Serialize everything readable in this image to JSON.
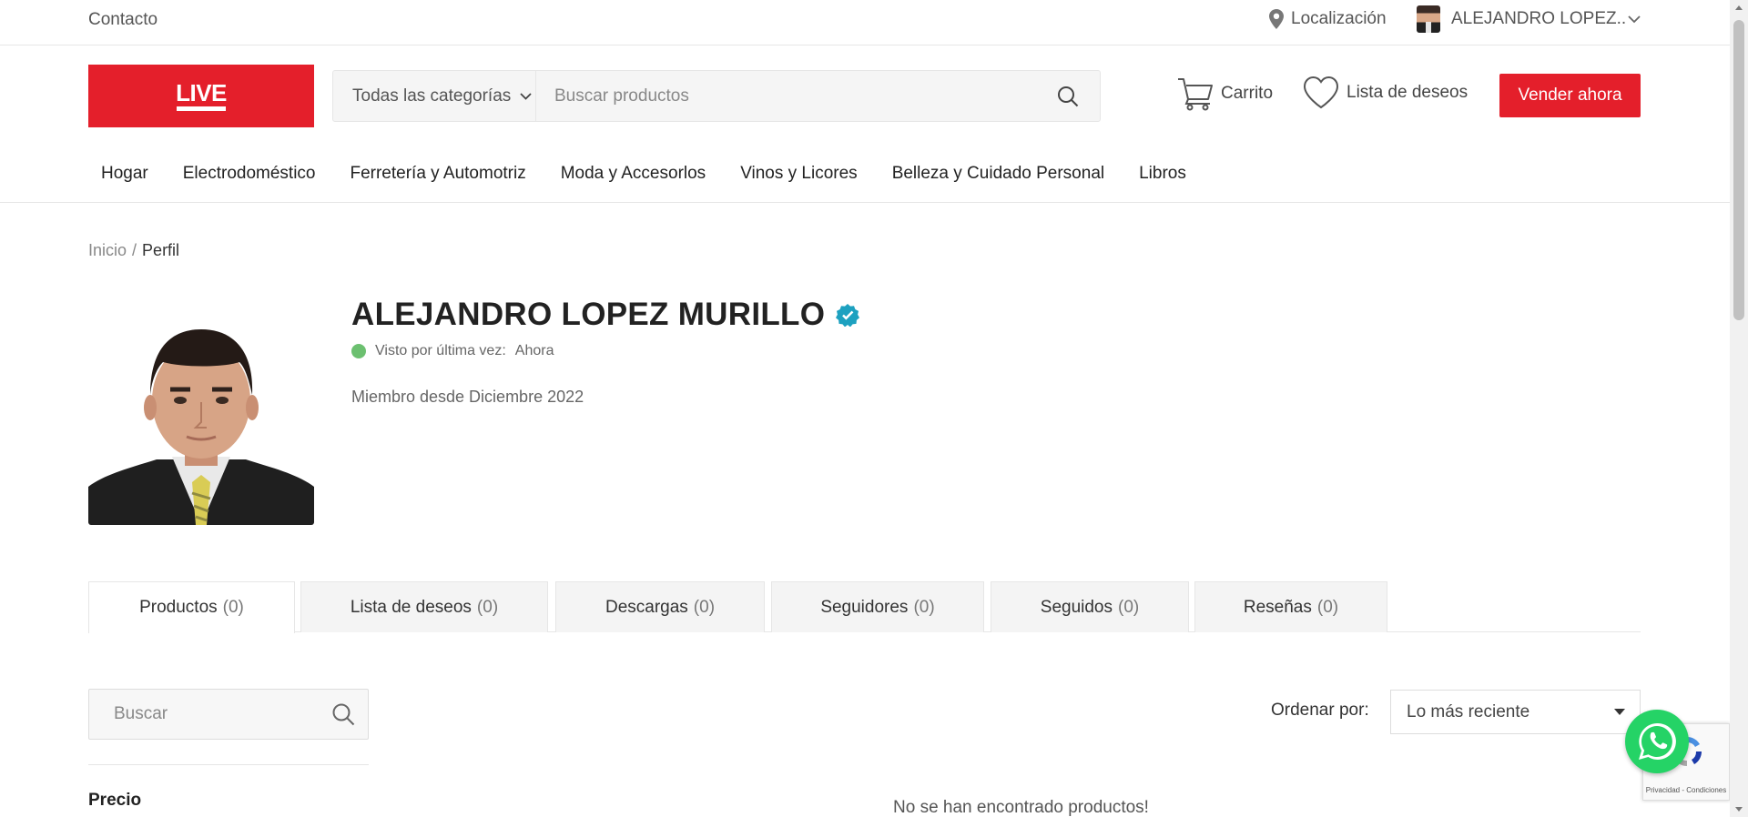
{
  "topbar": {
    "contact": "Contacto",
    "location": "Localización",
    "user": "ALEJANDRO LOPEZ.."
  },
  "header": {
    "logo_text": "LIVE",
    "search": {
      "category": "Todas las categorías",
      "placeholder": "Buscar productos"
    },
    "cart": "Carrito",
    "wishlist": "Lista de deseos",
    "sell": "Vender ahora"
  },
  "nav": [
    "Hogar",
    "Electrodoméstico",
    "Ferretería y Automotriz",
    "Moda y Accesorlos",
    "Vinos y Licores",
    "Belleza y Cuidado Personal",
    "Libros"
  ],
  "breadcrumb": {
    "home": "Inicio",
    "sep": "/",
    "current": "Perfil"
  },
  "profile": {
    "name": "ALEJANDRO LOPEZ MURILLO",
    "last_seen_label": "Visto por última vez:",
    "last_seen_value": "Ahora",
    "member_since": "Miembro desde Diciembre 2022"
  },
  "tabs": [
    {
      "label": "Productos",
      "count": "(0)"
    },
    {
      "label": "Lista de deseos",
      "count": "(0)"
    },
    {
      "label": "Descargas",
      "count": "(0)"
    },
    {
      "label": "Seguidores",
      "count": "(0)"
    },
    {
      "label": "Seguidos",
      "count": "(0)"
    },
    {
      "label": "Reseñas",
      "count": "(0)"
    }
  ],
  "sidebar": {
    "search_placeholder": "Buscar",
    "price_heading": "Precio"
  },
  "sort": {
    "label": "Ordenar por:",
    "value": "Lo más reciente"
  },
  "empty_message": "No se han encontrado productos!",
  "recaptcha": {
    "text": "Privacidad - Condiciones"
  },
  "colors": {
    "brand": "#e41f2b",
    "verified": "#1da1c0",
    "online": "#6cc070",
    "whatsapp": "#25d366"
  },
  "icons": {
    "location": "map-pin-icon",
    "user_dropdown": "chevron-down-icon",
    "search": "search-icon",
    "cart": "cart-icon",
    "wishlist": "heart-icon",
    "verified": "verified-badge-icon",
    "whatsapp": "whatsapp-icon"
  }
}
